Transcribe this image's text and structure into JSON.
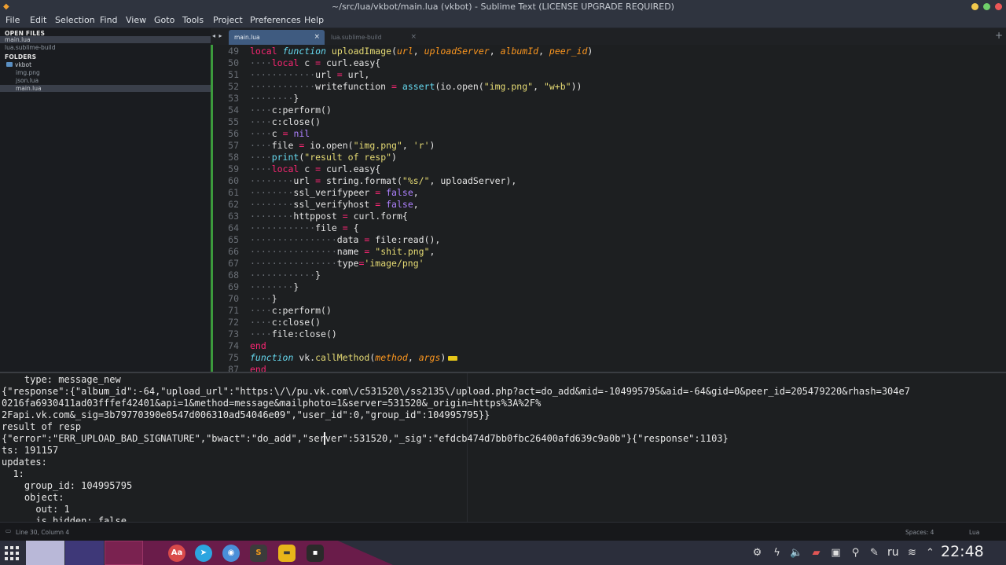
{
  "window": {
    "title": "~/src/lua/vkbot/main.lua (vkbot) - Sublime Text (LICENSE UPGRADE REQUIRED)"
  },
  "menu": [
    "File",
    "Edit",
    "Selection",
    "Find",
    "View",
    "Goto",
    "Tools",
    "Project",
    "Preferences",
    "Help"
  ],
  "sidebar": {
    "open_files_header": "OPEN FILES",
    "open_files": [
      "main.lua",
      "lua.sublime-build"
    ],
    "folders_header": "FOLDERS",
    "folder": "vkbot",
    "files": [
      "img.png",
      "json.lua",
      "main.lua"
    ]
  },
  "tabs": [
    {
      "label": "main.lua",
      "active": true
    },
    {
      "label": "lua.sublime-build",
      "active": false
    }
  ],
  "tab_nav": "◂ ▸",
  "tab_plus": "+",
  "code": {
    "line_numbers": [
      "49",
      "50",
      "51",
      "52",
      "53",
      "54",
      "55",
      "56",
      "57",
      "58",
      "59",
      "60",
      "61",
      "62",
      "63",
      "64",
      "65",
      "66",
      "67",
      "68",
      "69",
      "70",
      "71",
      "72",
      "73",
      "74",
      "75",
      "87"
    ],
    "lines": [
      "local function uploadImage(url, uploadServer, albumId, peer_id)",
      "    local c = curl.easy{",
      "            url = url,",
      "            writefunction = assert(io.open(\"img.png\", \"w+b\"))",
      "        }",
      "    c:perform()",
      "    c:close()",
      "    c = nil",
      "    file = io.open(\"img.png\", 'r')",
      "    print(\"result of resp\")",
      "    local c = curl.easy{",
      "        url = string.format(\"%s/\", uploadServer),",
      "        ssl_verifypeer = false,",
      "        ssl_verifyhost = false,",
      "        httppost = curl.form{",
      "            file = {",
      "                data = file:read(),",
      "                name = \"shit.png\",",
      "                type='image/png'",
      "            }",
      "        }",
      "    }",
      "    c:perform()",
      "    c:close()",
      "    file:close()",
      "end",
      "function vk.callMethod(method, args)",
      "end"
    ]
  },
  "output": [
    "    type: message_new",
    "{\"response\":{\"album_id\":-64,\"upload_url\":\"https:\\/\\/pu.vk.com\\/c531520\\/ss2135\\/upload.php?act=do_add&mid=-104995795&aid=-64&gid=0&peer_id=205479220&rhash=304e7",
    "0216fa6930411ad03fffef42401&api=1&method=message&mailphoto=1&server=531520&_origin=https%3A%2F%",
    "2Fapi.vk.com&_sig=3b79770390e0547d006310ad54046e09\",\"user_id\":0,\"group_id\":104995795}}",
    "result of resp",
    "{\"error\":\"ERR_UPLOAD_BAD_SIGNATURE\",\"bwact\":\"do_add\",\"server\":531520,\"_sig\":\"efdcb474d7bb0fbc26400afd639c9a0b\"}{\"response\":1103}",
    "ts: 191157",
    "updates:",
    "  1:",
    "    group_id: 104995795",
    "    object:",
    "      out: 1",
    "      is_hidden: false"
  ],
  "status": {
    "position": "Line 30, Column 4",
    "spaces": "Spaces: 4",
    "syntax": "Lua"
  },
  "taskbar": {
    "apps": [
      "Aa",
      "telegram",
      "chromium",
      "sublime",
      "files",
      "terminal"
    ],
    "lang": "ru",
    "clock": "22:48"
  },
  "colors": {
    "accent_tab": "#3f5b80",
    "gutter_modified": "#3c9a3c",
    "taskbar_wedge": "#6a1c4a"
  }
}
